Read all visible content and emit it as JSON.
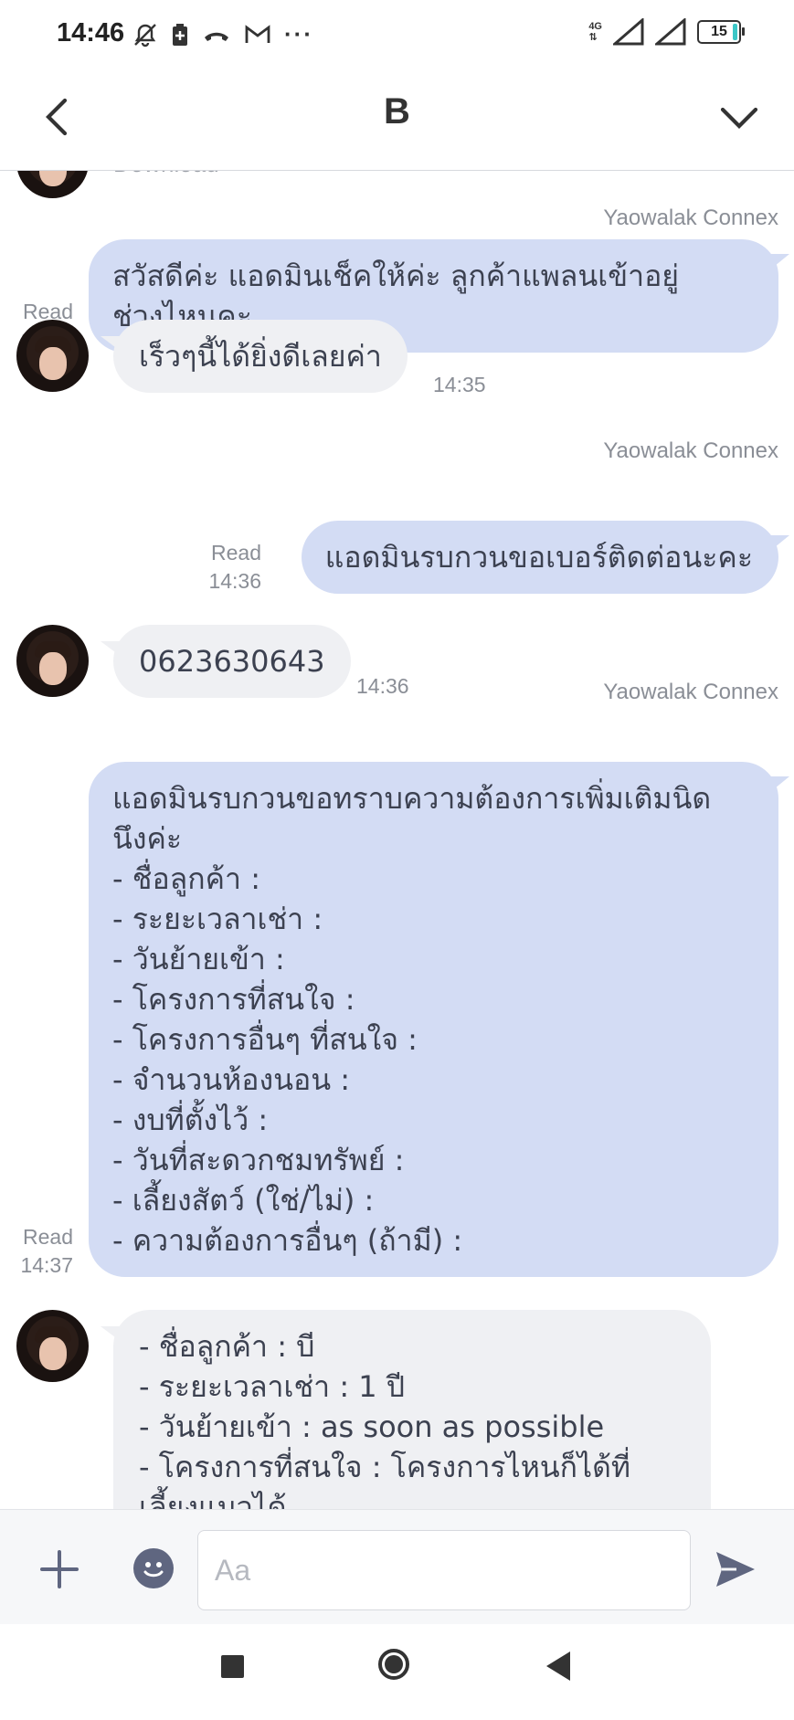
{
  "status_bar": {
    "time": "14:46",
    "more": "···",
    "network": "4G",
    "battery": "15"
  },
  "header": {
    "title": "B"
  },
  "messages": {
    "m0_partial": "Download",
    "m1": {
      "sender": "Yaowalak Connex",
      "text": "สวัสดีค่ะ แอดมินเช็คให้ค่ะ ลูกค้าแพลนเข้าอยู่\nช่วงไหนคะ",
      "read": "Read",
      "time": "14:35"
    },
    "m2": {
      "text": "เร็วๆนี้ได้ยิ่งดีเลยค่า",
      "time": "14:35"
    },
    "m3": {
      "sender": "Yaowalak Connex",
      "text": "แอดมินรบกวนขอเบอร์ติดต่อนะคะ",
      "read": "Read",
      "time": "14:36"
    },
    "m4": {
      "text": "0623630643",
      "time": "14:36"
    },
    "m5": {
      "sender": "Yaowalak Connex",
      "text": "แอดมินรบกวนขอทราบความต้องการเพิ่มเติมนิด\nนึงค่ะ\n- ชื่อลูกค้า :\n- ระยะเวลาเช่า :\n- วันย้ายเข้า :\n- โครงการที่สนใจ :\n- โครงการอื่นๆ ที่สนใจ :\n- จำนวนห้องนอน :\n- งบที่ตั้งไว้ :\n- วันที่สะดวกชมทรัพย์ :\n- เลี้ยงสัตว์ (ใช่/ไม่) :\n- ความต้องการอื่นๆ (ถ้ามี) :",
      "read": "Read",
      "time": "14:37"
    },
    "m6": {
      "text": "- ชื่อลูกค้า : บี\n- ระยะเวลาเช่า : 1 ปี\n- วันย้ายเข้า : as soon as possible\n- โครงการที่สนใจ : โครงการไหนก็ได้ที่\nเลี้ยงแมวได้"
    }
  },
  "input": {
    "placeholder": "Aa"
  },
  "icons": {
    "back": "chevron-left-icon",
    "menu": "chevron-down-icon",
    "plus": "plus-icon",
    "emoji": "smiley-icon",
    "send": "send-icon"
  },
  "colors": {
    "outgoing_bubble": "#d3dcf4",
    "incoming_bubble": "#eff0f3",
    "icon_accent": "#5f6680"
  }
}
